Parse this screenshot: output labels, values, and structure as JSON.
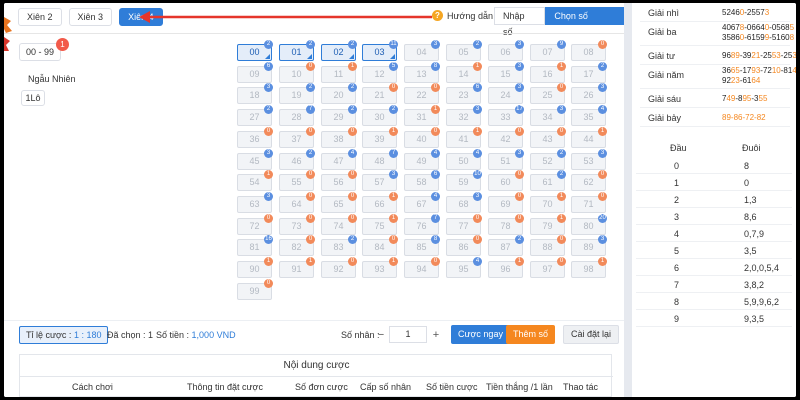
{
  "tabs": [
    {
      "label": "Xiên 2",
      "active": false
    },
    {
      "label": "Xiên 3",
      "active": false
    },
    {
      "label": "Xiên 4",
      "active": true
    }
  ],
  "guide_label": "Hướng dẫn",
  "modes": [
    {
      "label": "Nhập số",
      "active": false
    },
    {
      "label": "Chọn số nhanh",
      "active": true
    }
  ],
  "range_label": "00 - 99",
  "range_badge": "1",
  "random_label": "Ngẫu Nhiên",
  "one_lo_label": "1Lô",
  "numbers": [
    {
      "n": "00",
      "c": "2",
      "t": "blue",
      "sel": true
    },
    {
      "n": "01",
      "c": "2",
      "t": "blue",
      "sel": true
    },
    {
      "n": "02",
      "c": "2",
      "t": "blue",
      "sel": true
    },
    {
      "n": "03",
      "c": "11",
      "t": "blue",
      "sel": true
    },
    {
      "n": "04",
      "c": "3",
      "t": "blue"
    },
    {
      "n": "05",
      "c": "2",
      "t": "blue"
    },
    {
      "n": "06",
      "c": "3",
      "t": "blue"
    },
    {
      "n": "07",
      "c": "9",
      "t": "blue"
    },
    {
      "n": "08",
      "c": "0",
      "t": "orange"
    },
    {
      "n": "09",
      "c": "6",
      "t": "blue"
    },
    {
      "n": "10",
      "c": "0",
      "t": "orange"
    },
    {
      "n": "11",
      "c": "1",
      "t": "orange"
    },
    {
      "n": "12",
      "c": "5",
      "t": "blue"
    },
    {
      "n": "13",
      "c": "8",
      "t": "blue"
    },
    {
      "n": "14",
      "c": "1",
      "t": "orange"
    },
    {
      "n": "15",
      "c": "3",
      "t": "blue"
    },
    {
      "n": "16",
      "c": "1",
      "t": "orange"
    },
    {
      "n": "17",
      "c": "2",
      "t": "blue"
    },
    {
      "n": "18",
      "c": "3",
      "t": "blue"
    },
    {
      "n": "19",
      "c": "2",
      "t": "blue"
    },
    {
      "n": "20",
      "c": "2",
      "t": "blue"
    },
    {
      "n": "21",
      "c": "0",
      "t": "orange"
    },
    {
      "n": "22",
      "c": "0",
      "t": "orange"
    },
    {
      "n": "23",
      "c": "6",
      "t": "blue"
    },
    {
      "n": "24",
      "c": "3",
      "t": "blue"
    },
    {
      "n": "25",
      "c": "0",
      "t": "orange"
    },
    {
      "n": "26",
      "c": "3",
      "t": "blue"
    },
    {
      "n": "27",
      "c": "2",
      "t": "blue"
    },
    {
      "n": "28",
      "c": "7",
      "t": "blue"
    },
    {
      "n": "29",
      "c": "2",
      "t": "blue"
    },
    {
      "n": "30",
      "c": "2",
      "t": "blue"
    },
    {
      "n": "31",
      "c": "1",
      "t": "orange"
    },
    {
      "n": "32",
      "c": "3",
      "t": "blue"
    },
    {
      "n": "33",
      "c": "17",
      "t": "blue"
    },
    {
      "n": "34",
      "c": "3",
      "t": "blue"
    },
    {
      "n": "35",
      "c": "4",
      "t": "blue"
    },
    {
      "n": "36",
      "c": "0",
      "t": "orange"
    },
    {
      "n": "37",
      "c": "0",
      "t": "orange"
    },
    {
      "n": "38",
      "c": "0",
      "t": "orange"
    },
    {
      "n": "39",
      "c": "1",
      "t": "orange"
    },
    {
      "n": "40",
      "c": "0",
      "t": "orange"
    },
    {
      "n": "41",
      "c": "1",
      "t": "orange"
    },
    {
      "n": "42",
      "c": "0",
      "t": "orange"
    },
    {
      "n": "43",
      "c": "0",
      "t": "orange"
    },
    {
      "n": "44",
      "c": "1",
      "t": "orange"
    },
    {
      "n": "45",
      "c": "3",
      "t": "blue"
    },
    {
      "n": "46",
      "c": "2",
      "t": "blue"
    },
    {
      "n": "47",
      "c": "4",
      "t": "blue"
    },
    {
      "n": "48",
      "c": "7",
      "t": "blue"
    },
    {
      "n": "49",
      "c": "4",
      "t": "blue"
    },
    {
      "n": "50",
      "c": "4",
      "t": "blue"
    },
    {
      "n": "51",
      "c": "3",
      "t": "blue"
    },
    {
      "n": "52",
      "c": "2",
      "t": "blue"
    },
    {
      "n": "53",
      "c": "3",
      "t": "blue"
    },
    {
      "n": "54",
      "c": "1",
      "t": "orange"
    },
    {
      "n": "55",
      "c": "0",
      "t": "orange"
    },
    {
      "n": "56",
      "c": "0",
      "t": "orange"
    },
    {
      "n": "57",
      "c": "3",
      "t": "blue"
    },
    {
      "n": "58",
      "c": "6",
      "t": "blue"
    },
    {
      "n": "59",
      "c": "10",
      "t": "blue"
    },
    {
      "n": "60",
      "c": "0",
      "t": "orange"
    },
    {
      "n": "61",
      "c": "2",
      "t": "blue"
    },
    {
      "n": "62",
      "c": "0",
      "t": "orange"
    },
    {
      "n": "63",
      "c": "3",
      "t": "blue"
    },
    {
      "n": "64",
      "c": "0",
      "t": "orange"
    },
    {
      "n": "65",
      "c": "0",
      "t": "orange"
    },
    {
      "n": "66",
      "c": "1",
      "t": "orange"
    },
    {
      "n": "67",
      "c": "4",
      "t": "blue"
    },
    {
      "n": "68",
      "c": "3",
      "t": "blue"
    },
    {
      "n": "69",
      "c": "0",
      "t": "orange"
    },
    {
      "n": "70",
      "c": "1",
      "t": "orange"
    },
    {
      "n": "71",
      "c": "0",
      "t": "orange"
    },
    {
      "n": "72",
      "c": "0",
      "t": "orange"
    },
    {
      "n": "73",
      "c": "0",
      "t": "orange"
    },
    {
      "n": "74",
      "c": "0",
      "t": "orange"
    },
    {
      "n": "75",
      "c": "1",
      "t": "orange"
    },
    {
      "n": "76",
      "c": "7",
      "t": "blue"
    },
    {
      "n": "77",
      "c": "0",
      "t": "orange"
    },
    {
      "n": "78",
      "c": "0",
      "t": "orange"
    },
    {
      "n": "79",
      "c": "1",
      "t": "orange"
    },
    {
      "n": "80",
      "c": "20",
      "t": "blue"
    },
    {
      "n": "81",
      "c": "16",
      "t": "blue"
    },
    {
      "n": "82",
      "c": "0",
      "t": "orange"
    },
    {
      "n": "83",
      "c": "2",
      "t": "blue"
    },
    {
      "n": "84",
      "c": "0",
      "t": "orange"
    },
    {
      "n": "85",
      "c": "8",
      "t": "blue"
    },
    {
      "n": "86",
      "c": "0",
      "t": "orange"
    },
    {
      "n": "87",
      "c": "2",
      "t": "blue"
    },
    {
      "n": "88",
      "c": "0",
      "t": "orange"
    },
    {
      "n": "89",
      "c": "3",
      "t": "blue"
    },
    {
      "n": "90",
      "c": "1",
      "t": "orange"
    },
    {
      "n": "91",
      "c": "1",
      "t": "orange"
    },
    {
      "n": "92",
      "c": "0",
      "t": "orange"
    },
    {
      "n": "93",
      "c": "1",
      "t": "orange"
    },
    {
      "n": "94",
      "c": "0",
      "t": "orange"
    },
    {
      "n": "95",
      "c": "4",
      "t": "blue"
    },
    {
      "n": "96",
      "c": "1",
      "t": "orange"
    },
    {
      "n": "97",
      "c": "0",
      "t": "orange"
    },
    {
      "n": "98",
      "c": "1",
      "t": "orange"
    },
    {
      "n": "99",
      "c": "0",
      "t": "orange"
    }
  ],
  "bet_bar": {
    "ratio_label": "Tỉ lệ cược :",
    "ratio_value": "1 : 180",
    "chosen_label": "Đã chọn : 1",
    "amount_label": "Số tiền :",
    "amount_value": "1,000 VND",
    "multiplier_label": "Số nhân :",
    "minus": "−",
    "multiplier_value": "1",
    "plus": "+",
    "bet_now": "Cược ngay",
    "add_number": "Thêm số",
    "reset": "Cài đặt lại"
  },
  "content": {
    "title": "Nội dung cược",
    "columns": [
      "Cách chơi",
      "Thông tin đặt cược",
      "Số đơn cược",
      "Cấp số nhân",
      "Số tiền cược",
      "Tiền thắng /1 lần",
      "Thao tác"
    ]
  },
  "prizes": [
    {
      "label": "Giải nhì",
      "lines": [
        [
          "5246",
          "0",
          "-2557",
          "3",
          ""
        ]
      ]
    },
    {
      "label": "Giải ba",
      "lines": [
        [
          "4067",
          "8",
          "-0664",
          "0",
          "-0568",
          "5",
          ""
        ],
        [
          "3586",
          "0",
          "-6159",
          "9",
          "-5160",
          "8",
          ""
        ]
      ]
    },
    {
      "label": "Giải tư",
      "lines": [
        [
          "96",
          "89",
          "-39",
          "21",
          "-25",
          "53",
          "-25",
          "36",
          ""
        ]
      ]
    },
    {
      "label": "Giải năm",
      "lines": [
        [
          "36",
          "65",
          "-17",
          "93",
          "-72",
          "10",
          "-81",
          "47",
          ""
        ],
        [
          "92",
          "23",
          "-61",
          "64",
          ""
        ]
      ]
    },
    {
      "label": "Giải sáu",
      "lines": [
        [
          "7",
          "49",
          "-8",
          "95",
          "-3",
          "55",
          ""
        ]
      ]
    },
    {
      "label": "Giải bảy",
      "lines": [
        [
          "",
          "89-86-72-82",
          ""
        ]
      ]
    }
  ],
  "tail_table": {
    "head": [
      "Đầu",
      "Đuôi"
    ],
    "rows": [
      [
        "0",
        "8"
      ],
      [
        "1",
        "0"
      ],
      [
        "2",
        "1,3"
      ],
      [
        "3",
        "8,6"
      ],
      [
        "4",
        "0,7,9"
      ],
      [
        "5",
        "3,5"
      ],
      [
        "6",
        "2,0,0,5,4"
      ],
      [
        "7",
        "3,8,2"
      ],
      [
        "8",
        "5,9,9,6,2"
      ],
      [
        "9",
        "9,3,5"
      ]
    ]
  },
  "colors": {
    "accent": "#2f7dd8",
    "orange": "#f5871f",
    "red": "#e5352b"
  }
}
